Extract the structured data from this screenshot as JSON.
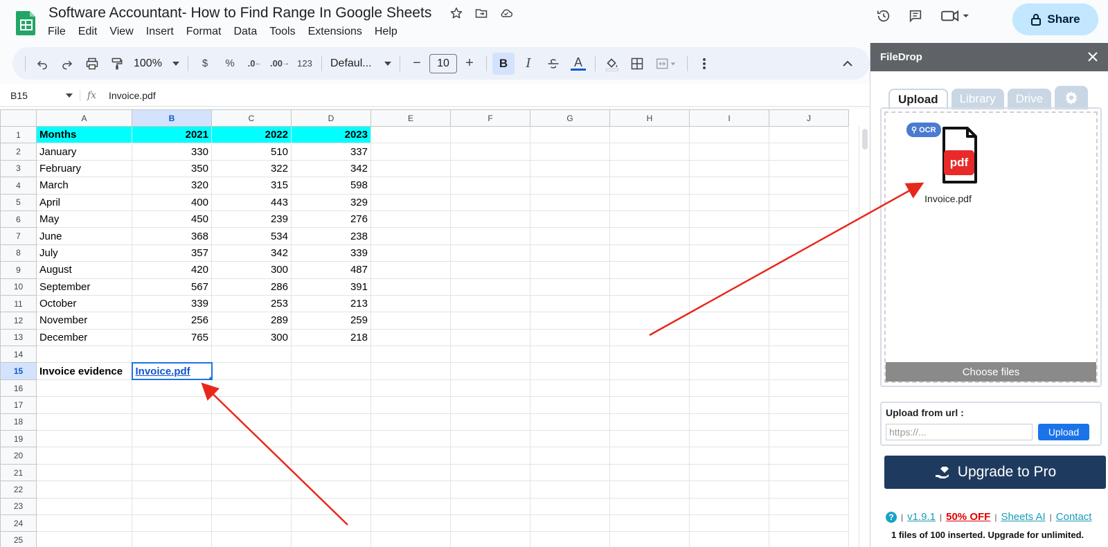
{
  "doc": {
    "title": "Software Accountant- How to Find Range In Google Sheets",
    "menu": [
      "File",
      "Edit",
      "View",
      "Insert",
      "Format",
      "Data",
      "Tools",
      "Extensions",
      "Help"
    ],
    "share_label": "Share"
  },
  "toolbar": {
    "zoom": "100%",
    "currency": "$",
    "percent": "%",
    "dec_decrease": ".0",
    "dec_increase": ".00",
    "number_format": "123",
    "font": "Defaul...",
    "font_size": "10",
    "bold": "B",
    "italic": "I",
    "text_color": "A"
  },
  "formula_bar": {
    "cell_ref": "B15",
    "fx": "fx",
    "value": "Invoice.pdf"
  },
  "sheet": {
    "columns": [
      "A",
      "B",
      "C",
      "D",
      "E",
      "F",
      "G",
      "H",
      "I",
      "J"
    ],
    "rows": [
      {
        "n": "1",
        "a": "Months",
        "b": "2021",
        "c": "2022",
        "d": "2023"
      },
      {
        "n": "2",
        "a": "January",
        "b": "330",
        "c": "510",
        "d": "337"
      },
      {
        "n": "3",
        "a": "February",
        "b": "350",
        "c": "322",
        "d": "342"
      },
      {
        "n": "4",
        "a": "March",
        "b": "320",
        "c": "315",
        "d": "598"
      },
      {
        "n": "5",
        "a": "April",
        "b": "400",
        "c": "443",
        "d": "329"
      },
      {
        "n": "6",
        "a": "May",
        "b": "450",
        "c": "239",
        "d": "276"
      },
      {
        "n": "7",
        "a": "June",
        "b": "368",
        "c": "534",
        "d": "238"
      },
      {
        "n": "8",
        "a": "July",
        "b": "357",
        "c": "342",
        "d": "339"
      },
      {
        "n": "9",
        "a": "August",
        "b": "420",
        "c": "300",
        "d": "487"
      },
      {
        "n": "10",
        "a": "September",
        "b": "567",
        "c": "286",
        "d": "391"
      },
      {
        "n": "11",
        "a": "October",
        "b": "339",
        "c": "253",
        "d": "213"
      },
      {
        "n": "12",
        "a": "November",
        "b": "256",
        "c": "289",
        "d": "259"
      },
      {
        "n": "13",
        "a": "December",
        "b": "765",
        "c": "300",
        "d": "218"
      },
      {
        "n": "14",
        "a": "",
        "b": "",
        "c": "",
        "d": ""
      },
      {
        "n": "15",
        "a": "Invoice evidence",
        "b": "Invoice.pdf",
        "c": "",
        "d": ""
      },
      {
        "n": "16",
        "a": "",
        "b": "",
        "c": "",
        "d": ""
      },
      {
        "n": "17",
        "a": "",
        "b": "",
        "c": "",
        "d": ""
      },
      {
        "n": "18",
        "a": "",
        "b": "",
        "c": "",
        "d": ""
      },
      {
        "n": "19",
        "a": "",
        "b": "",
        "c": "",
        "d": ""
      },
      {
        "n": "20",
        "a": "",
        "b": "",
        "c": "",
        "d": ""
      },
      {
        "n": "21",
        "a": "",
        "b": "",
        "c": "",
        "d": ""
      },
      {
        "n": "22",
        "a": "",
        "b": "",
        "c": "",
        "d": ""
      },
      {
        "n": "23",
        "a": "",
        "b": "",
        "c": "",
        "d": ""
      },
      {
        "n": "24",
        "a": "",
        "b": "",
        "c": "",
        "d": ""
      },
      {
        "n": "25",
        "a": "",
        "b": "",
        "c": "",
        "d": ""
      }
    ]
  },
  "sidebar": {
    "title": "FileDrop",
    "tabs": [
      "Upload",
      "Library",
      "Drive"
    ],
    "file": {
      "badge": "OCR",
      "type": "pdf",
      "name": "Invoice.pdf"
    },
    "choose_files": "Choose files",
    "url_label": "Upload from url :",
    "url_placeholder": "https://...",
    "url_button": "Upload",
    "upgrade_label": "Upgrade to Pro",
    "links": {
      "help": "?",
      "version": "v1.9.1",
      "sale": "50% OFF",
      "ai": "Sheets AI",
      "contact": "Contact"
    },
    "note": "1 files of 100 inserted. Upgrade for unlimited."
  },
  "colors": {
    "header_cyan": "#00ffff",
    "accent_blue": "#1a73e8",
    "share_bg": "#c2e7ff",
    "upgrade_bg": "#1f3a5f",
    "arrow_red": "#e8271b"
  }
}
